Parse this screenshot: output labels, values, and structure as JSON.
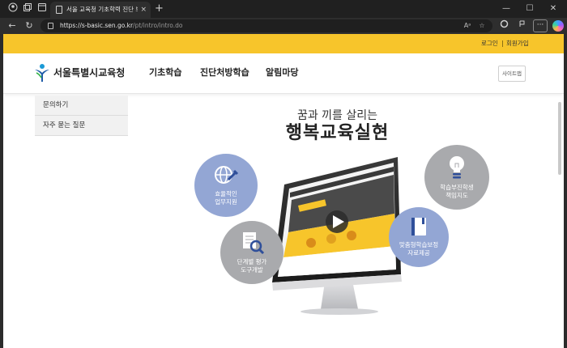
{
  "browser": {
    "tab_title": "서울 교육청 기초학력 진단 보정",
    "tab_close": "×",
    "new_tab": "+",
    "url_host": "https://s-basic.sen.go.kr",
    "url_path": "/pt/intro/intro.do",
    "back": "←",
    "reload": "↻",
    "win_minimize": "—",
    "win_maximize": "☐",
    "win_close": "✕",
    "menu": "···"
  },
  "site": {
    "top_links": {
      "login": "로그인",
      "join": "회원가입"
    },
    "logo_text": "서울특별시교육청",
    "nav": [
      "기초학습",
      "진단처방학습",
      "알림마당"
    ],
    "sitemap": "사이트맵",
    "side_menu": [
      "문의하기",
      "자주 묻는 질문"
    ],
    "hero": {
      "subtitle": "꿈과 끼를 살리는",
      "title": "행복교육실현"
    },
    "features": [
      {
        "line1": "효율적인",
        "line2": "업무지원",
        "icon": "globe-wrench-icon"
      },
      {
        "line1": "단계별 평가",
        "line2": "도구개발",
        "icon": "magnifier-document-icon"
      },
      {
        "line1": "학습부진학생",
        "line2": "책임지도",
        "icon": "lightbulb-icon"
      },
      {
        "line1": "맞춤형학습보정",
        "line2": "자료제공",
        "icon": "book-icon"
      }
    ]
  },
  "colors": {
    "brand_yellow": "#f7c52b",
    "circle_blue": "#93a6d4",
    "circle_gray": "#a9aaad"
  }
}
